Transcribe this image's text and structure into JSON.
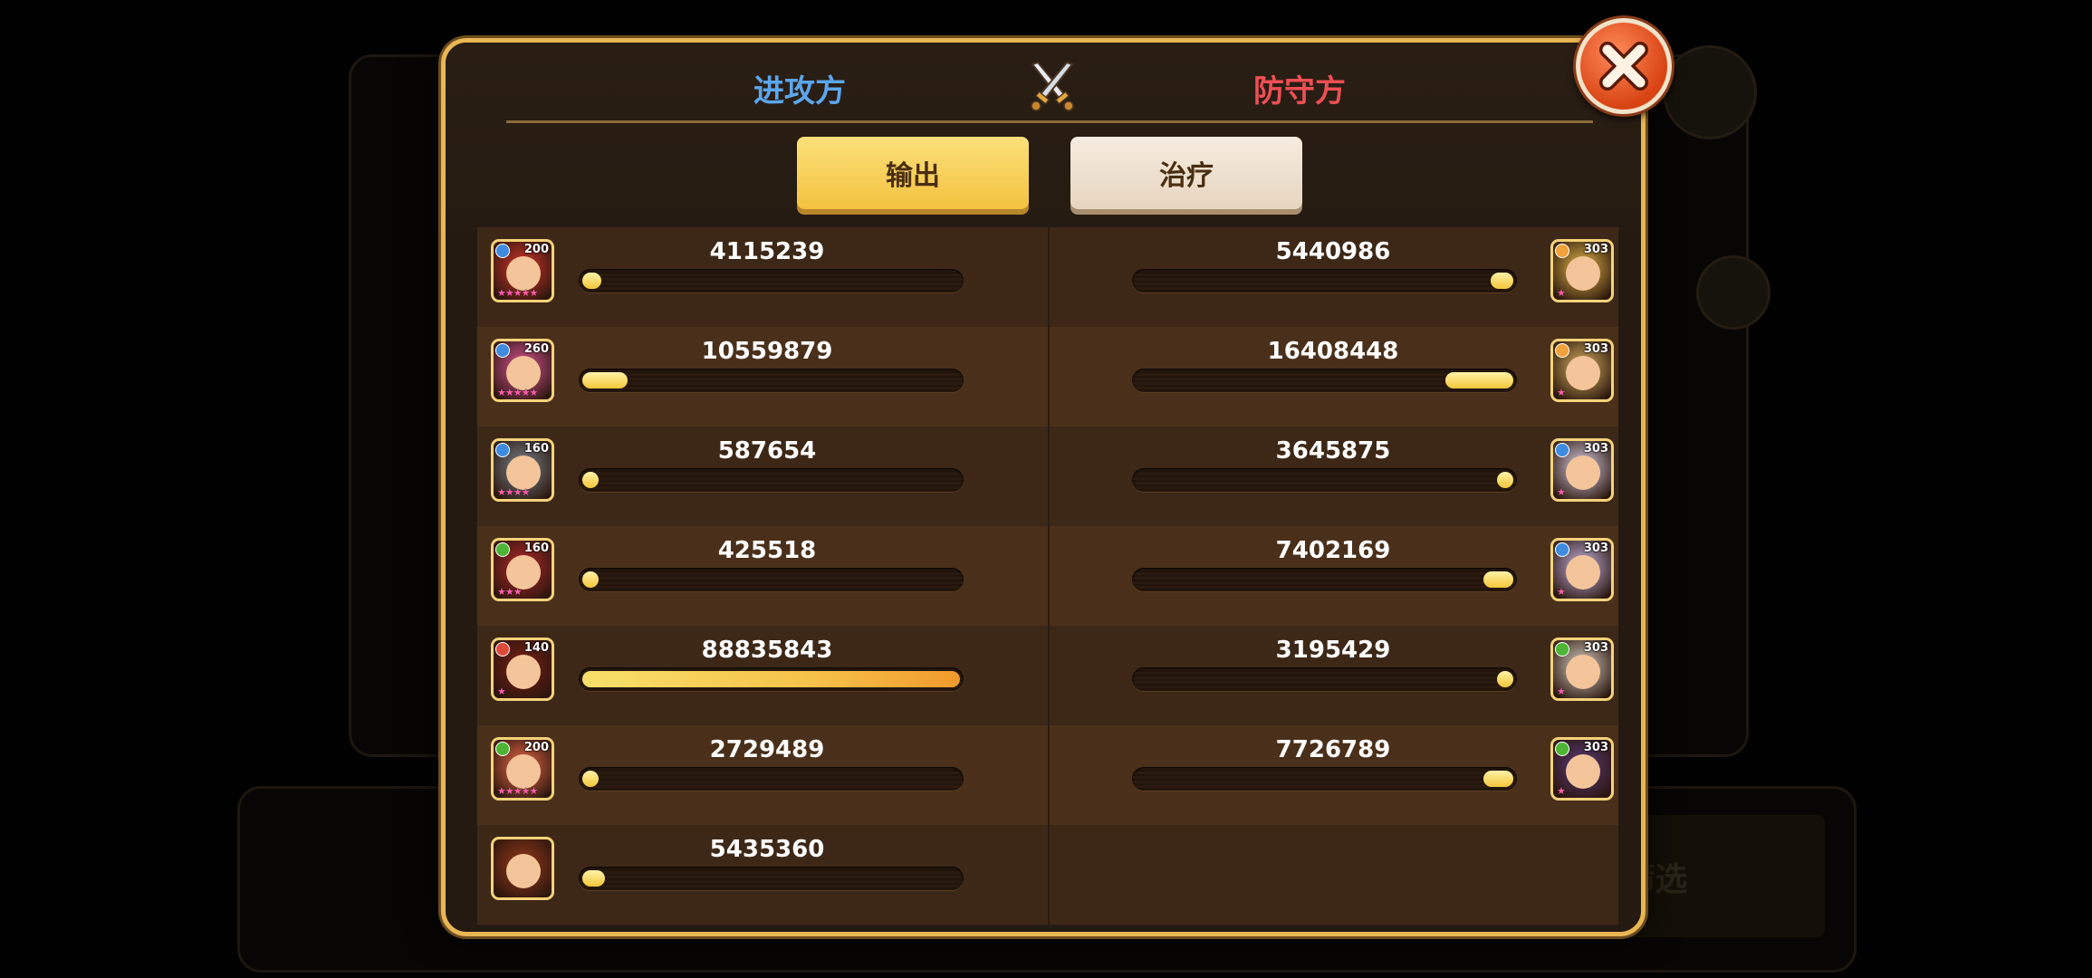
{
  "header": {
    "attacker_label": "进攻方",
    "defender_label": "防守方"
  },
  "tabs": {
    "output_label": "输出",
    "heal_label": "治疗",
    "active": "output"
  },
  "background": {
    "filter_label": "筛选"
  },
  "attackers": [
    {
      "value": "4115239",
      "level": "200",
      "stars": "★★★★★",
      "fill": 0.05,
      "faction_color": "#3f8be0",
      "avatar_color": "#d9362c"
    },
    {
      "value": "10559879",
      "level": "260",
      "stars": "★★★★★",
      "fill": 0.12,
      "faction_color": "#3f8be0",
      "avatar_color": "#e0569a"
    },
    {
      "value": "587654",
      "level": "160",
      "stars": "★★★★",
      "fill": 0.01,
      "faction_color": "#3f8be0",
      "avatar_color": "#7b8590"
    },
    {
      "value": "425518",
      "level": "160",
      "stars": "★★★",
      "fill": 0.01,
      "faction_color": "#4cb536",
      "avatar_color": "#b8282c"
    },
    {
      "value": "88835843",
      "level": "140",
      "stars": "★",
      "fill": 1.0,
      "faction_color": "#e04a3a",
      "avatar_color": "#7a1e16"
    },
    {
      "value": "2729489",
      "level": "200",
      "stars": "★★★★★",
      "fill": 0.03,
      "faction_color": "#4cb536",
      "avatar_color": "#ee6a4a"
    },
    {
      "value": "5435360",
      "level": "",
      "stars": "",
      "fill": 0.06,
      "faction_color": "",
      "avatar_color": "#9a3a1c"
    }
  ],
  "defenders": [
    {
      "value": "5440986",
      "level": "303",
      "stars": "★",
      "fill": 0.06,
      "faction_color": "#f2a23a",
      "avatar_color": "#e6b84a"
    },
    {
      "value": "16408448",
      "level": "303",
      "stars": "★",
      "fill": 0.18,
      "faction_color": "#f2a23a",
      "avatar_color": "#d8b060"
    },
    {
      "value": "3645875",
      "level": "303",
      "stars": "★",
      "fill": 0.04,
      "faction_color": "#3f8be0",
      "avatar_color": "#dcd0e6"
    },
    {
      "value": "7402169",
      "level": "303",
      "stars": "★",
      "fill": 0.08,
      "faction_color": "#3f8be0",
      "avatar_color": "#c9b6e8"
    },
    {
      "value": "3195429",
      "level": "303",
      "stars": "★",
      "fill": 0.04,
      "faction_color": "#4cb536",
      "avatar_color": "#dcd2c6"
    },
    {
      "value": "7726789",
      "level": "303",
      "stars": "★",
      "fill": 0.08,
      "faction_color": "#4cb536",
      "avatar_color": "#5a3a7a"
    }
  ],
  "colors": {
    "attacker": "#5ba6ee",
    "defender": "#ee4f55",
    "modal_border": "#e9b654"
  }
}
